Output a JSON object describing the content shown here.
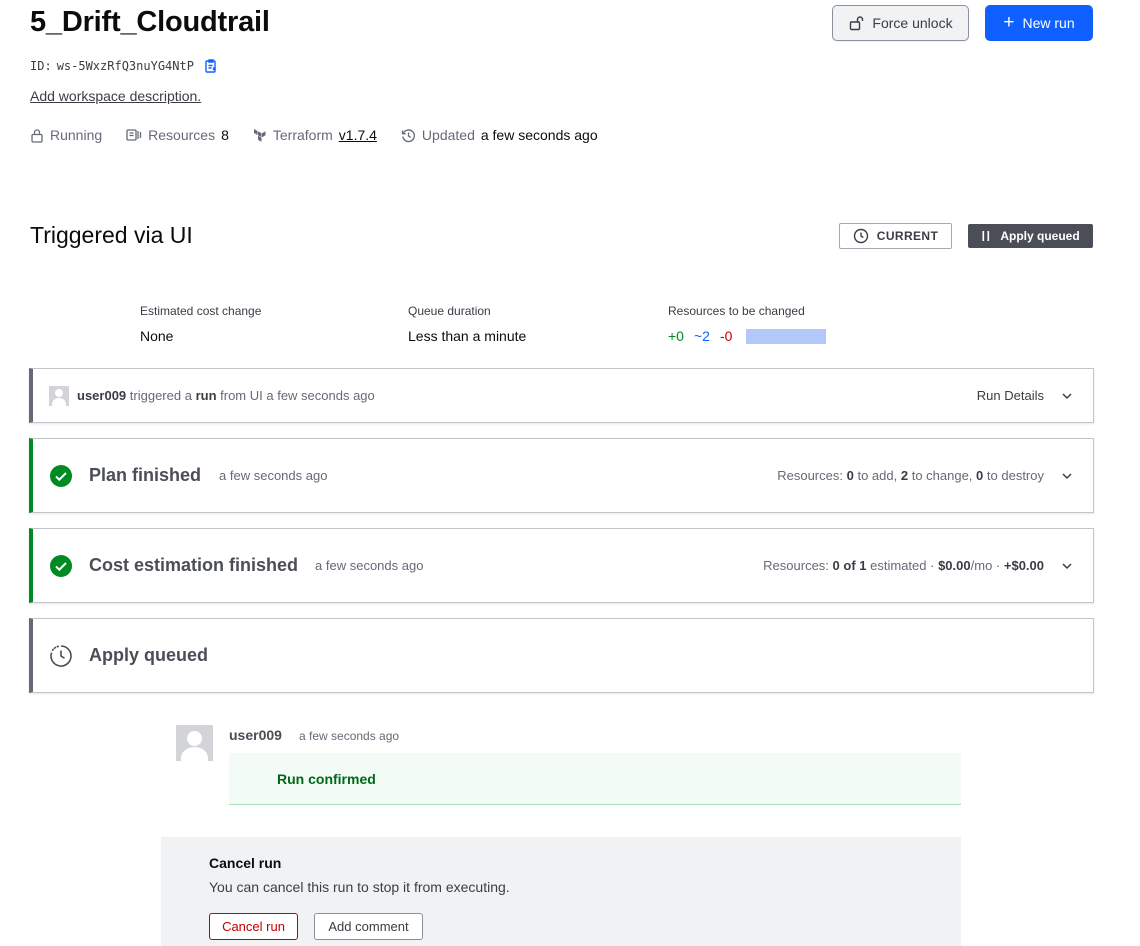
{
  "workspace": {
    "title": "5_Drift_Cloudtrail",
    "id_label": "ID:",
    "id_value": "ws-5WxzRfQ3nuYG4NtP",
    "add_description": "Add workspace description.",
    "buttons": {
      "force_unlock": "Force unlock",
      "new_run": "New run"
    },
    "meta": {
      "status": "Running",
      "resources_label": "Resources",
      "resources_count": "8",
      "terraform_label": "Terraform",
      "terraform_version": "v1.7.4",
      "updated_label": "Updated",
      "updated_value": "a few seconds ago"
    }
  },
  "run": {
    "title": "Triggered via UI",
    "badge_current": "CURRENT",
    "badge_status": "Apply queued",
    "stats": {
      "cost_label": "Estimated cost change",
      "cost_value": "None",
      "queue_label": "Queue duration",
      "queue_value": "Less than a minute",
      "resources_label": "Resources to be changed",
      "add": "+0",
      "change": "~2",
      "destroy": "-0"
    },
    "trigger": {
      "user": "user009",
      "text1": "triggered a",
      "run_word": "run",
      "text2": "from UI a few seconds ago",
      "details": "Run Details"
    },
    "plan": {
      "title": "Plan finished",
      "time": "a few seconds ago",
      "res_label": "Resources:",
      "add": "0",
      "add_text": "to add,",
      "change": "2",
      "change_text": "to change,",
      "destroy": "0",
      "destroy_text": "to destroy"
    },
    "cost": {
      "title": "Cost estimation finished",
      "time": "a few seconds ago",
      "res_label": "Resources:",
      "estimated_count": "0 of 1",
      "estimated_text": "estimated ·",
      "monthly": "$0.00",
      "monthly_suffix": "/mo ·",
      "delta": "+$0.00"
    },
    "apply": {
      "title": "Apply queued"
    },
    "comment": {
      "user": "user009",
      "time": "a few seconds ago",
      "text": "Run confirmed"
    },
    "cancel": {
      "title": "Cancel run",
      "description": "You can cancel this run to stop it from executing.",
      "cancel_button": "Cancel run",
      "comment_button": "Add comment"
    }
  },
  "colors": {
    "primary": "#1060ff",
    "success": "#008a22",
    "danger": "#c00005",
    "badge_dark": "#4b4e57",
    "change_bar": "#b1c8f8"
  }
}
